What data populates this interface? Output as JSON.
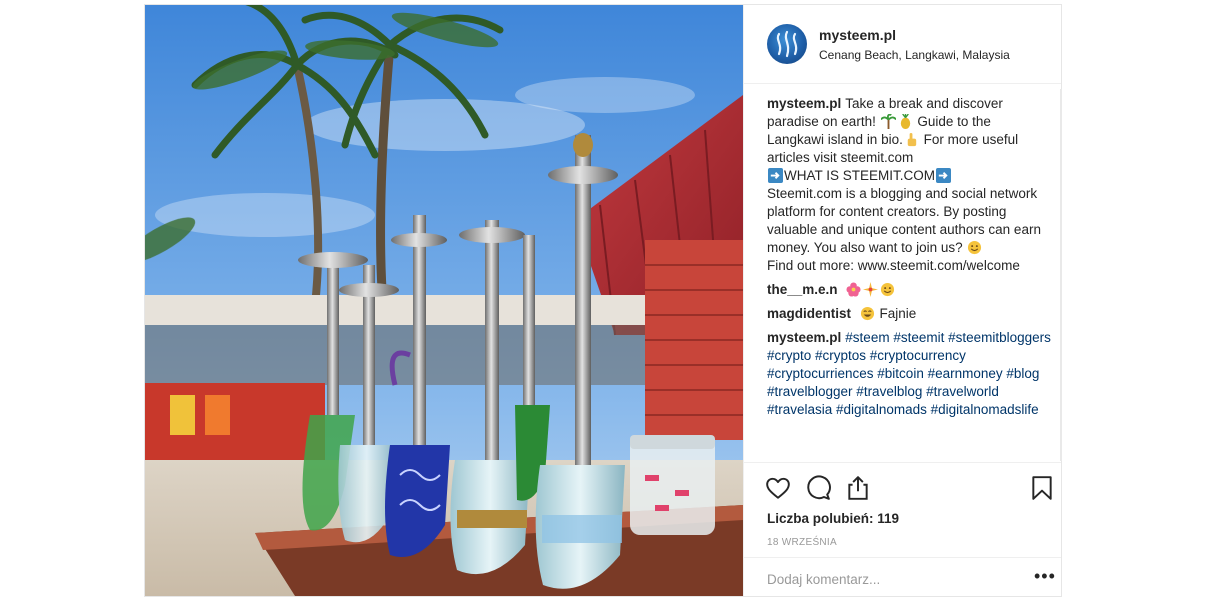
{
  "header": {
    "username": "mysteem.pl",
    "location": "Cenang Beach, Langkawi, Malaysia"
  },
  "caption": {
    "username": "mysteem.pl",
    "line1": "Take a break and discover paradise on earth!",
    "line2": "Guide to the Langkawi island in bio.",
    "line3": "For more useful articles visit steemit.com",
    "line4": "WHAT IS STEEMIT.COM",
    "line5": "Steemit.com is a blogging and social network platform for content creators. By posting valuable and unique content authors can earn money. You also want to join us?",
    "line6": "Find out more: www.steemit.com/welcome"
  },
  "comments": [
    {
      "username": "the__m.e.n",
      "text": ""
    },
    {
      "username": "magdidentist",
      "text": "Fajnie"
    },
    {
      "username": "mysteem.pl",
      "text": "#steem #steemit #steemitbloggers #crypto #cryptos #cryptocurrency #cryptocurriences #bitcoin #earnmoney #blog #travelblogger #travelblog #travelworld #travelasia #digitalnomads #digitalnomadslife"
    }
  ],
  "actions": {
    "likes": "Liczba polubień: 119",
    "date": "18 WRZEŚNIA",
    "add_comment_placeholder": "Dodaj komentarz...",
    "more_options": "•••"
  },
  "icons": {
    "like": "heart-icon",
    "comment": "comment-bubble-icon",
    "share": "share-icon",
    "save": "bookmark-icon",
    "emoji": [
      "palm-tree",
      "pineapple",
      "pointing-hand",
      "right-arrow",
      "smile",
      "hibiscus",
      "sparkle",
      "grin"
    ]
  },
  "colors": {
    "hashtag": "#003569",
    "muted": "#999999",
    "border": "#efefef"
  }
}
